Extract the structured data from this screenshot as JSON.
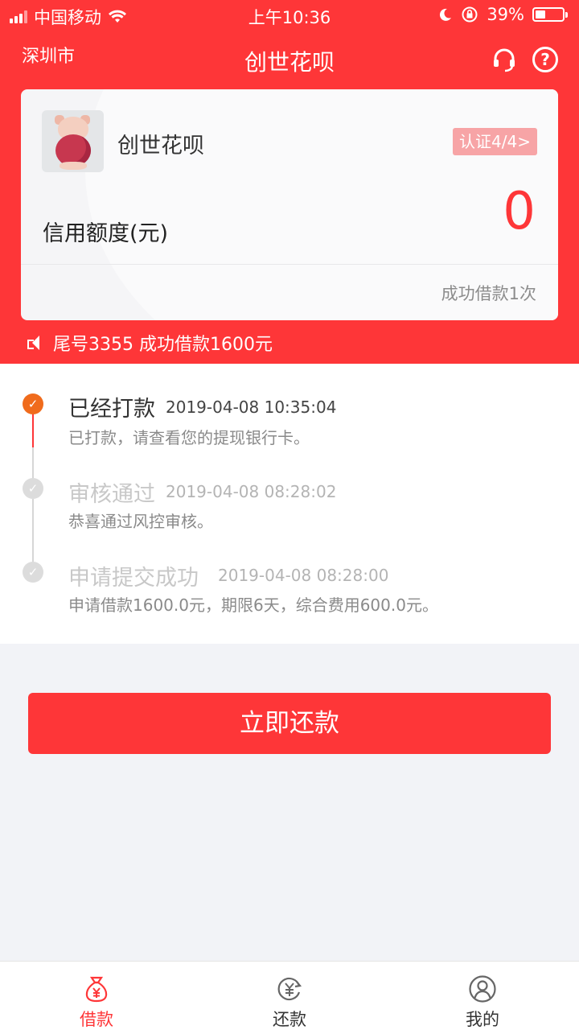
{
  "status_bar": {
    "carrier": "中国移动",
    "time": "上午10:36",
    "battery": "39%"
  },
  "nav": {
    "city": "深圳市",
    "title": "创世花呗"
  },
  "card": {
    "name": "创世花呗",
    "cert_badge": "认证4/4>",
    "credit_label": "信用额度(元)",
    "credit_value": "0",
    "loan_count": "成功借款1次"
  },
  "notice": {
    "text": "尾号3355 成功借款1600元"
  },
  "timeline": [
    {
      "title": "已经打款",
      "time": "2019-04-08 10:35:04",
      "desc": "已打款，请查看您的提现银行卡。",
      "active": true
    },
    {
      "title": "审核通过",
      "time": "2019-04-08 08:28:02",
      "desc": "恭喜通过风控审核。",
      "active": false
    },
    {
      "title": "申请提交成功",
      "time": "2019-04-08 08:28:00",
      "desc": "申请借款1600.0元，期限6天，综合费用600.0元。",
      "active": false
    }
  ],
  "action": {
    "repay_label": "立即还款"
  },
  "tabbar": {
    "items": [
      {
        "label": "借款",
        "icon": "money-bag-icon",
        "active": true
      },
      {
        "label": "还款",
        "icon": "yen-refresh-icon",
        "active": false
      },
      {
        "label": "我的",
        "icon": "user-icon",
        "active": false
      }
    ]
  },
  "colors": {
    "brand_red": "#fe3638",
    "step_active": "#f06b1c",
    "step_inactive": "#dcdcdc"
  }
}
